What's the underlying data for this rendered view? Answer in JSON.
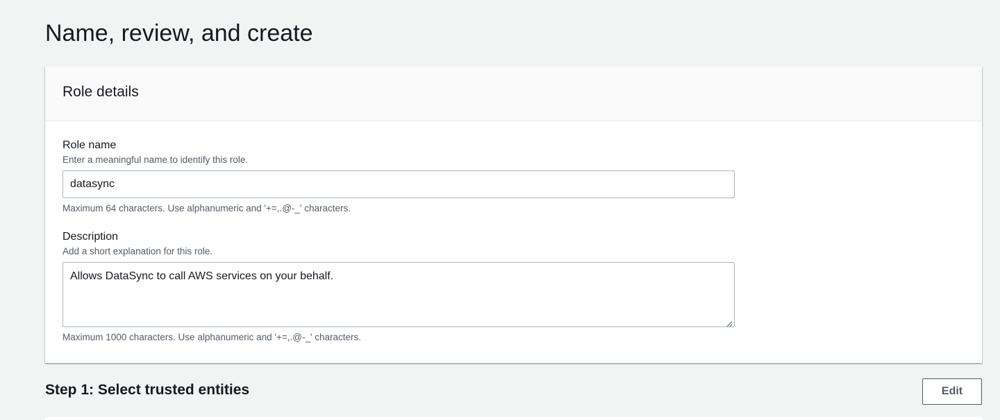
{
  "page": {
    "title": "Name, review, and create"
  },
  "role_details": {
    "header": "Role details",
    "role_name": {
      "label": "Role name",
      "description": "Enter a meaningful name to identify this role.",
      "value": "datasync",
      "constraint": "Maximum 64 characters. Use alphanumeric and '+=,.@-_' characters."
    },
    "description": {
      "label": "Description",
      "description": "Add a short explanation for this role.",
      "value": "Allows DataSync to call AWS services on your behalf.",
      "constraint": "Maximum 1000 characters. Use alphanumeric and '+=,.@-_' characters."
    }
  },
  "step1": {
    "title": "Step 1: Select trusted entities",
    "edit_label": "Edit"
  },
  "icons": {
    "resize": "resize-grip-icon"
  },
  "colors": {
    "background": "#f2f3f3",
    "card": "#ffffff",
    "card_header": "#fafafa",
    "text": "#16191f",
    "secondary_text": "#545b64",
    "input_border": "#aab7b8"
  }
}
